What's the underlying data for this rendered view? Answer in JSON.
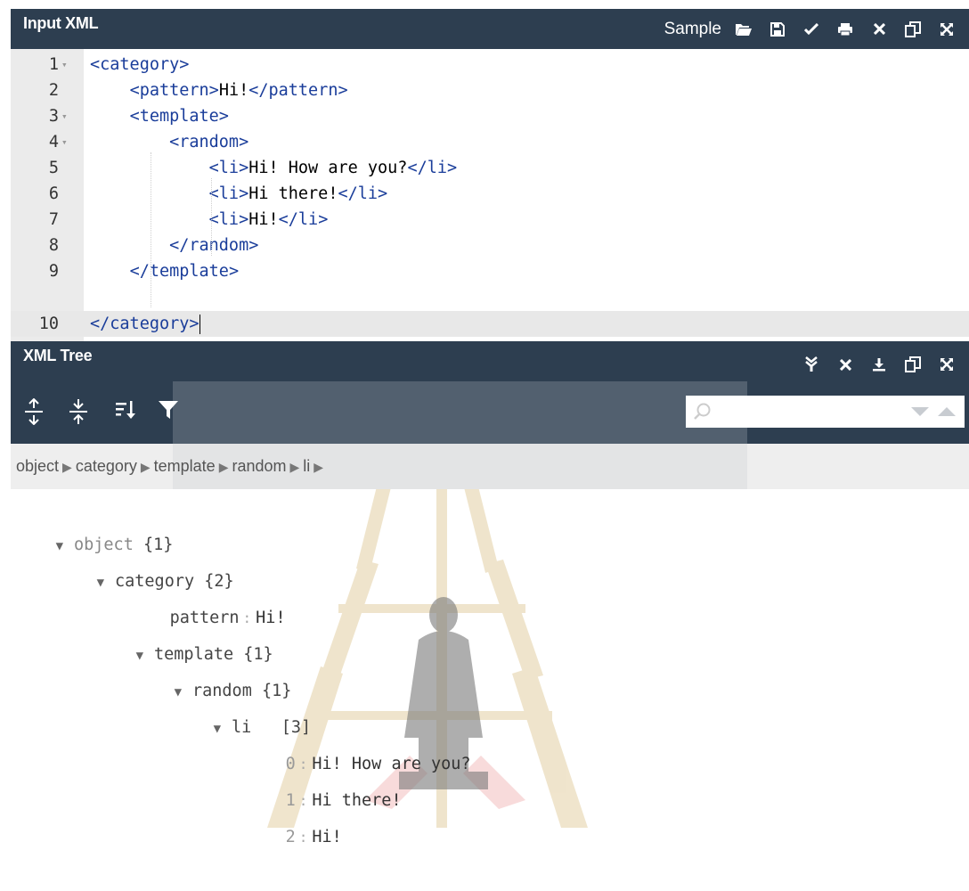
{
  "input_panel": {
    "title": "Input XML",
    "sample_label": "Sample",
    "icons": [
      "folder-open-icon",
      "save-icon",
      "check-icon",
      "print-icon",
      "close-icon",
      "copy-icon",
      "fullscreen-icon"
    ]
  },
  "editor": {
    "lines": [
      {
        "num": "1",
        "code": "<category>"
      },
      {
        "num": "2",
        "code": "    <pattern>Hi!</pattern>"
      },
      {
        "num": "3",
        "code": "    <template>"
      },
      {
        "num": "4",
        "code": "        <random>"
      },
      {
        "num": "5",
        "code": "            <li>Hi! How are you?</li>"
      },
      {
        "num": "6",
        "code": "            <li>Hi there!</li>"
      },
      {
        "num": "7",
        "code": "            <li>Hi!</li>"
      },
      {
        "num": "8",
        "code": "        </random>"
      },
      {
        "num": "9",
        "code": "    </template>"
      },
      {
        "num": "10",
        "code": "</category>"
      }
    ]
  },
  "tree_panel": {
    "title": "XML Tree",
    "icons": [
      "collapse-down-icon",
      "close-icon",
      "download-icon",
      "copy-icon",
      "fullscreen-icon"
    ],
    "toolbar_icons": [
      "expand-all-icon",
      "collapse-all-icon",
      "sort-icon",
      "filter-icon"
    ],
    "search_placeholder": "",
    "breadcrumb": [
      "object",
      "category",
      "template",
      "random",
      "li"
    ]
  },
  "tree": {
    "object": {
      "key": "object",
      "count": "{1}"
    },
    "category": {
      "key": "category",
      "count": "{2}"
    },
    "pattern": {
      "key": "pattern",
      "value": "Hi!"
    },
    "template": {
      "key": "template",
      "count": "{1}"
    },
    "random": {
      "key": "random",
      "count": "{1}"
    },
    "li": {
      "key": "li",
      "count": "[3]"
    },
    "items": [
      {
        "index": "0",
        "value": "Hi! How are you?"
      },
      {
        "index": "1",
        "value": "Hi there!"
      },
      {
        "index": "2",
        "value": "Hi!"
      }
    ]
  },
  "colors": {
    "header_bg": "#2d3e50",
    "tag_blue": "#1a3d9a",
    "gutter": "#ebebeb"
  }
}
